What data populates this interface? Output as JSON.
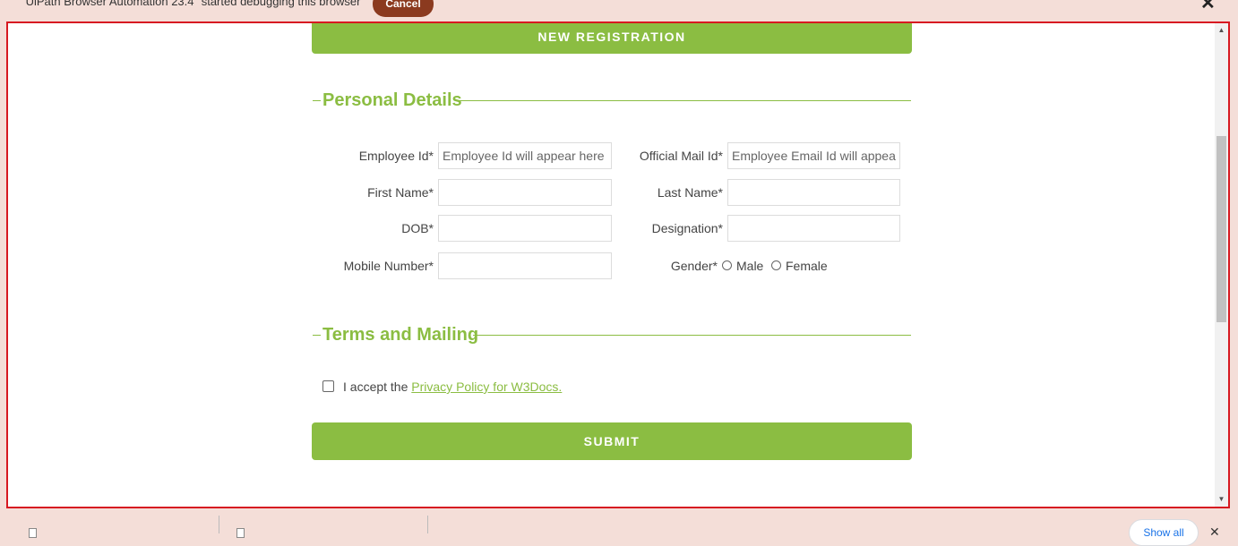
{
  "debug_bar": {
    "message": "\"UiPath Browser Automation 23.4\" started debugging this browser",
    "cancel_label": "Cancel",
    "close_glyph": "✕"
  },
  "form": {
    "new_registration_label": "NEW REGISTRATION",
    "personal_details_title": "Personal Details",
    "fields": {
      "employee_id_label": "Employee Id*",
      "employee_id_placeholder": "Employee Id will appear here",
      "official_mail_label": "Official Mail Id*",
      "official_mail_placeholder": "Employee Email Id will appear",
      "first_name_label": "First Name*",
      "first_name_value": "",
      "last_name_label": "Last Name*",
      "last_name_value": "",
      "dob_label": "DOB*",
      "dob_value": "",
      "designation_label": "Designation*",
      "designation_value": "",
      "mobile_label": "Mobile Number*",
      "mobile_value": "",
      "gender_label": "Gender*",
      "gender_options": [
        "Male",
        "Female"
      ]
    },
    "terms_title": "Terms and Mailing",
    "terms": {
      "accept_text": "I accept the ",
      "policy_link": "Privacy Policy for W3Docs.",
      "checked": false
    },
    "submit_label": "SUBMIT"
  },
  "download_shelf": {
    "show_all_label": "Show all"
  },
  "colors": {
    "accent_green": "#8bbd42",
    "highlight_red": "#d71921",
    "cancel_brown": "#8b3a1f",
    "banner_bg": "#f4ded8"
  }
}
